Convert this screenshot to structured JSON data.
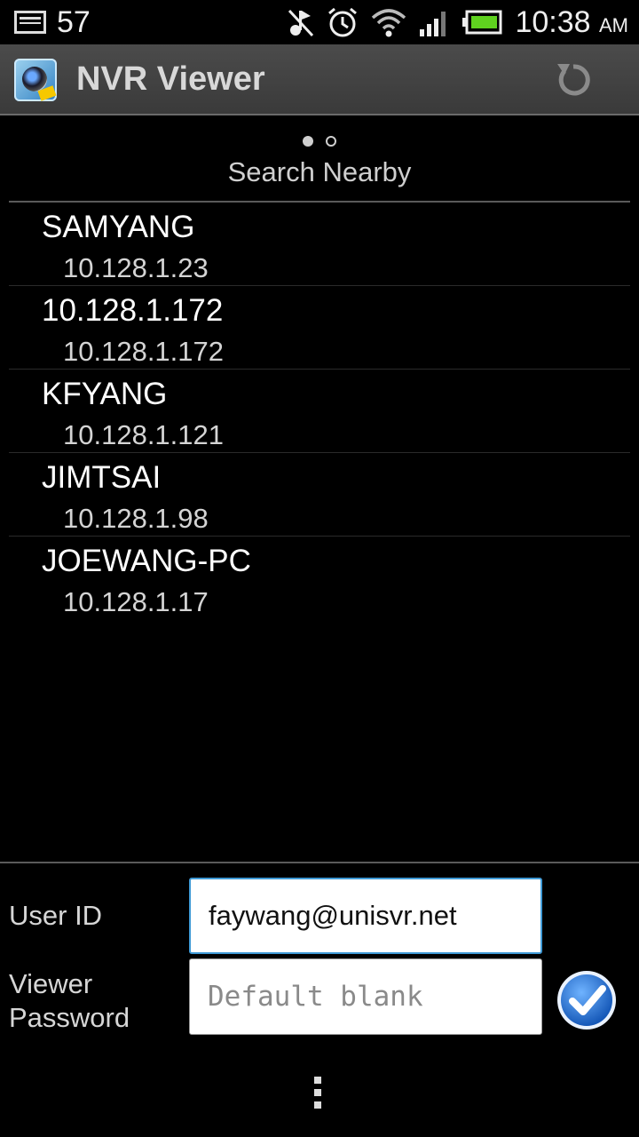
{
  "status_bar": {
    "notification_count": "57",
    "time": "10:38",
    "ampm": "AM",
    "icons": [
      "notification-icon",
      "muted-icon",
      "alarm-icon",
      "wifi-icon",
      "signal-icon",
      "battery-icon"
    ]
  },
  "app_bar": {
    "title": "NVR Viewer",
    "refresh_icon": "refresh-icon"
  },
  "pager": {
    "active_index": 0,
    "total": 2,
    "page_title": "Search Nearby"
  },
  "devices": [
    {
      "name": "SAMYANG",
      "ip": "10.128.1.23"
    },
    {
      "name": "10.128.1.172",
      "ip": "10.128.1.172"
    },
    {
      "name": "KFYANG",
      "ip": "10.128.1.121"
    },
    {
      "name": "JIMTSAI",
      "ip": "10.128.1.98"
    },
    {
      "name": "JOEWANG-PC",
      "ip": "10.128.1.17"
    }
  ],
  "form": {
    "user_id_label": "User ID",
    "user_id_value": "faywang@unisvr.net",
    "password_label_line1": "Viewer",
    "password_label_line2": "Password",
    "password_placeholder": "Default blank"
  },
  "colors": {
    "background": "#000000",
    "app_bar": "#444444",
    "focus_border": "#3f9ad6",
    "check_blue": "#1f6fd0"
  }
}
